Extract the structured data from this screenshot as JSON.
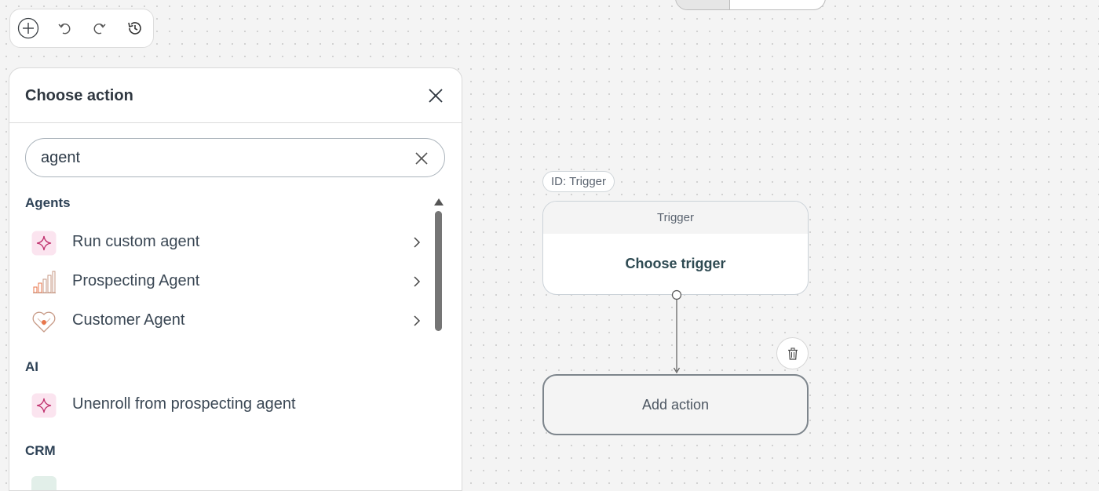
{
  "toolbar": {
    "add_icon": "plus-circle-icon",
    "undo_icon": "undo-icon",
    "redo_icon": "redo-icon",
    "history_icon": "history-icon"
  },
  "panel": {
    "title": "Choose action",
    "search": {
      "value": "agent",
      "placeholder": ""
    },
    "sections": [
      {
        "heading": "Agents",
        "items": [
          {
            "label": "Run custom agent",
            "icon": "sparkle-icon"
          },
          {
            "label": "Prospecting Agent",
            "icon": "bar-chart-icon"
          },
          {
            "label": "Customer Agent",
            "icon": "heart-icon"
          }
        ]
      },
      {
        "heading": "AI",
        "items": [
          {
            "label": "Unenroll from prospecting agent",
            "icon": "sparkle-icon"
          }
        ]
      },
      {
        "heading": "CRM",
        "items": []
      }
    ]
  },
  "canvas": {
    "trigger_id_badge": "ID: Trigger",
    "trigger_header": "Trigger",
    "trigger_body": "Choose trigger",
    "action_label": "Add action"
  },
  "colors": {
    "sparkle_bg": "#fbe4ef",
    "sparkle": "#c0326e",
    "accent_orange": "#e8764b"
  }
}
